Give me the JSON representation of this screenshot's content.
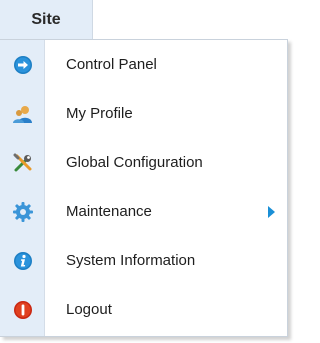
{
  "menu": {
    "tab_label": "Site",
    "items": [
      {
        "label": "Control Panel",
        "icon": "control-panel-icon",
        "submenu": false
      },
      {
        "label": "My Profile",
        "icon": "user-profile-icon",
        "submenu": false
      },
      {
        "label": "Global Configuration",
        "icon": "tools-icon",
        "submenu": false
      },
      {
        "label": "Maintenance",
        "icon": "gear-icon",
        "submenu": true
      },
      {
        "label": "System Information",
        "icon": "info-icon",
        "submenu": false
      },
      {
        "label": "Logout",
        "icon": "logout-icon",
        "submenu": false
      }
    ]
  },
  "colors": {
    "gutter": "#e3edf8",
    "accent_blue": "#1a8fd6",
    "logout_red": "#e0331a",
    "tools_green": "#3aa845",
    "gear_blue": "#3a95d8"
  }
}
